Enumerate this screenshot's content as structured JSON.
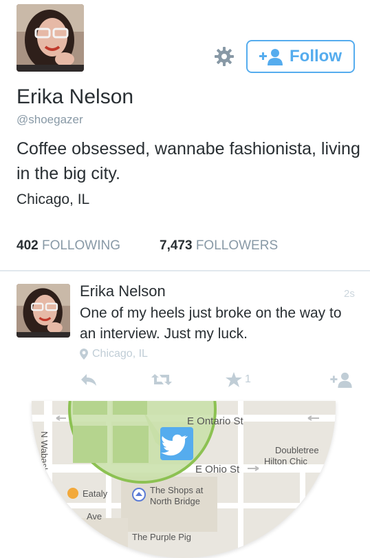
{
  "profile": {
    "name": "Erika Nelson",
    "handle": "@shoegazer",
    "bio": "Coffee obsessed, wannabe fashionista, living in the big city.",
    "location": "Chicago, IL",
    "follow_label": "Follow",
    "following_count": "402",
    "following_label": "FOLLOWING",
    "followers_count": "7,473",
    "followers_label": "FOLLOWERS"
  },
  "tweet": {
    "name": "Erika Nelson",
    "time": "2s",
    "text": "One of my heels just broke on the way to an interview. Just my luck.",
    "location": "Chicago, IL",
    "favorite_count": "1"
  },
  "map": {
    "labels": {
      "e_ontario": "E Ontario St",
      "e_ohio": "E Ohio St",
      "n_wabash": "N Wabash",
      "doubletree_1": "Doubletree",
      "doubletree_2": "Hilton Chic",
      "eataly": "Eataly",
      "shops_1": "The Shops at",
      "shops_2": "North Bridge",
      "ave": "Ave",
      "purple_pig": "The Purple Pig"
    }
  },
  "colors": {
    "accent": "#55acee",
    "text": "#292f33",
    "muted": "#8899a6",
    "icon_muted": "#c0cdd6",
    "map_green": "#8cc152"
  },
  "icons": [
    "gear-icon",
    "add-user-icon",
    "location-pin-icon",
    "reply-icon",
    "retweet-icon",
    "favorite-icon",
    "follow-user-icon",
    "twitter-bird-icon"
  ]
}
